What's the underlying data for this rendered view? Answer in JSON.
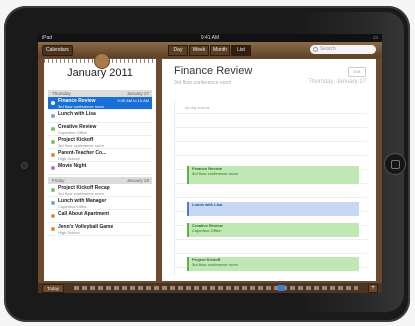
{
  "status": {
    "carrier": "iPad",
    "time": "9:41 AM"
  },
  "toolbar": {
    "calendars_label": "Calendars",
    "views": [
      "Day",
      "Week",
      "Month",
      "List"
    ],
    "active_view": "List",
    "search_placeholder": "Search"
  },
  "list": {
    "month": "January 2011",
    "day1": {
      "label": "Thursday",
      "date": "January 27"
    },
    "day2": {
      "label": "Friday",
      "date": "January 28"
    },
    "events_day1": [
      {
        "title": "Finance Review",
        "sub": "3rd floor conference room",
        "time": "9:30 AM to 10 AM",
        "color": "#1a6fd6",
        "selected": true
      },
      {
        "title": "Lunch with Lisa",
        "sub": "",
        "time": "",
        "color": "#7aa2e6"
      },
      {
        "title": "Creative Review",
        "sub": "Cupertino Office",
        "time": "",
        "color": "#79c26a"
      },
      {
        "title": "Project Kickoff",
        "sub": "3rd floor conference room",
        "time": "",
        "color": "#79c26a"
      },
      {
        "title": "Parent-Teacher Co...",
        "sub": "High School",
        "time": "",
        "color": "#e48a3a"
      },
      {
        "title": "Movie Night",
        "sub": "",
        "time": "",
        "color": "#b17ad3"
      }
    ],
    "events_day2": [
      {
        "title": "Project Kickoff Recap",
        "sub": "3rd floor conference room",
        "time": "",
        "color": "#79c26a"
      },
      {
        "title": "Lunch with Manager",
        "sub": "Cupertino Office",
        "time": "",
        "color": "#7aa2e6"
      },
      {
        "title": "Call About Apartment",
        "sub": "",
        "time": "",
        "color": "#e48a3a"
      },
      {
        "title": "Jenn's Volleyball Game",
        "sub": "High School",
        "time": "",
        "color": "#e48a3a"
      }
    ]
  },
  "detail": {
    "title": "Finance Review",
    "location": "3rd floor conference room",
    "date": "Thursday, January 27",
    "edit_label": "Edit",
    "all_day_label": "all-day events",
    "blocks": [
      {
        "title": "Finance Review",
        "sub": "3rd floor conference room",
        "bg": "#bfe8b5",
        "border": "#5fb14c",
        "color": "#2f6e22"
      },
      {
        "title": "Lunch with Lisa",
        "sub": "",
        "bg": "#c7d8f5",
        "border": "#4b7fd4",
        "color": "#234f9c"
      },
      {
        "title": "Creative Review",
        "sub": "Cupertino Office",
        "bg": "#bfe8b5",
        "border": "#5fb14c",
        "color": "#2f6e22"
      },
      {
        "title": "Project Kickoff",
        "sub": "3rd floor conference room",
        "bg": "#bfe8b5",
        "border": "#5fb14c",
        "color": "#2f6e22"
      }
    ]
  },
  "bottombar": {
    "today_label": "Today",
    "add_label": "+"
  }
}
